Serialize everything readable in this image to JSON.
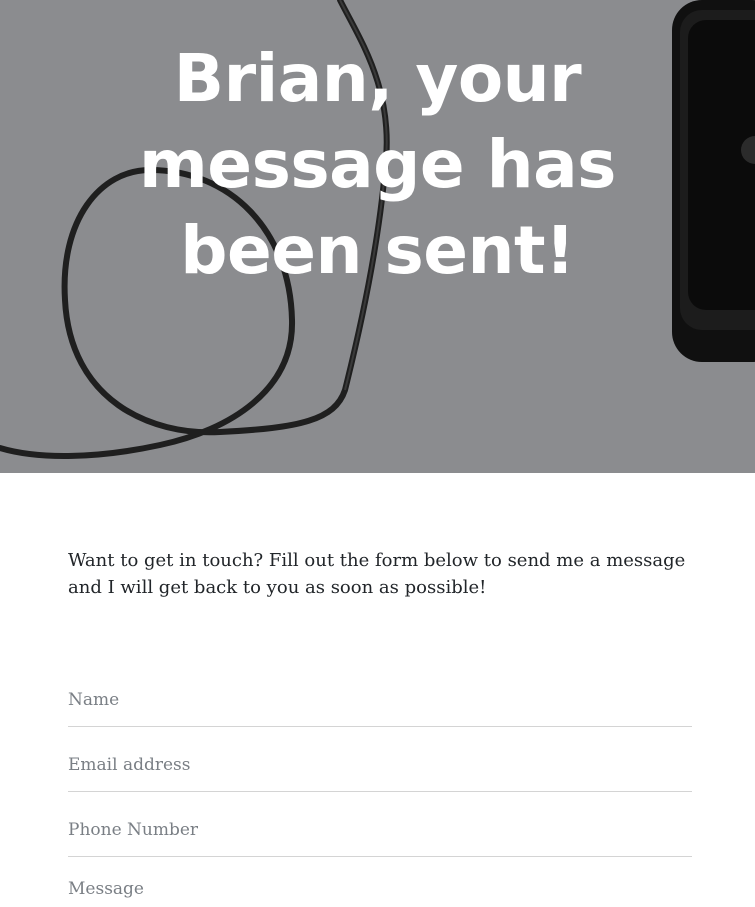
{
  "hero": {
    "title": "Brian, your message has been sent!"
  },
  "intro": {
    "text": "Want to get in touch? Fill out the form below to send me a message and I will get back to you as soon as possible!"
  },
  "form": {
    "name_placeholder": "Name",
    "email_placeholder": "Email address",
    "phone_placeholder": "Phone Number",
    "message_placeholder": "Message"
  },
  "colors": {
    "hero_overlay": "#8a8b8e",
    "title": "#ffffff",
    "body_text": "#212529",
    "placeholder": "#7a7f85",
    "divider": "#d4d4d4"
  }
}
